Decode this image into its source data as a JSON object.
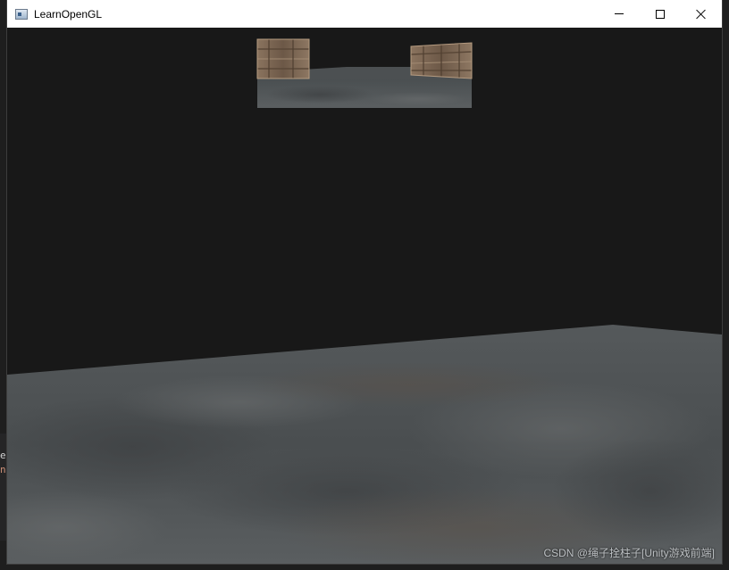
{
  "window": {
    "title": "LearnOpenGL",
    "controls": {
      "minimize_label": "Minimize",
      "maximize_label": "Maximize",
      "close_label": "Close"
    }
  },
  "background_editor": {
    "line1": "er",
    "line2": "n"
  },
  "watermark": "CSDN @绳子拴柱子[Unity游戏前端]",
  "colors": {
    "clear_color": "#181818",
    "floor": "#4d5153",
    "crate_wood": "#7a6450"
  }
}
